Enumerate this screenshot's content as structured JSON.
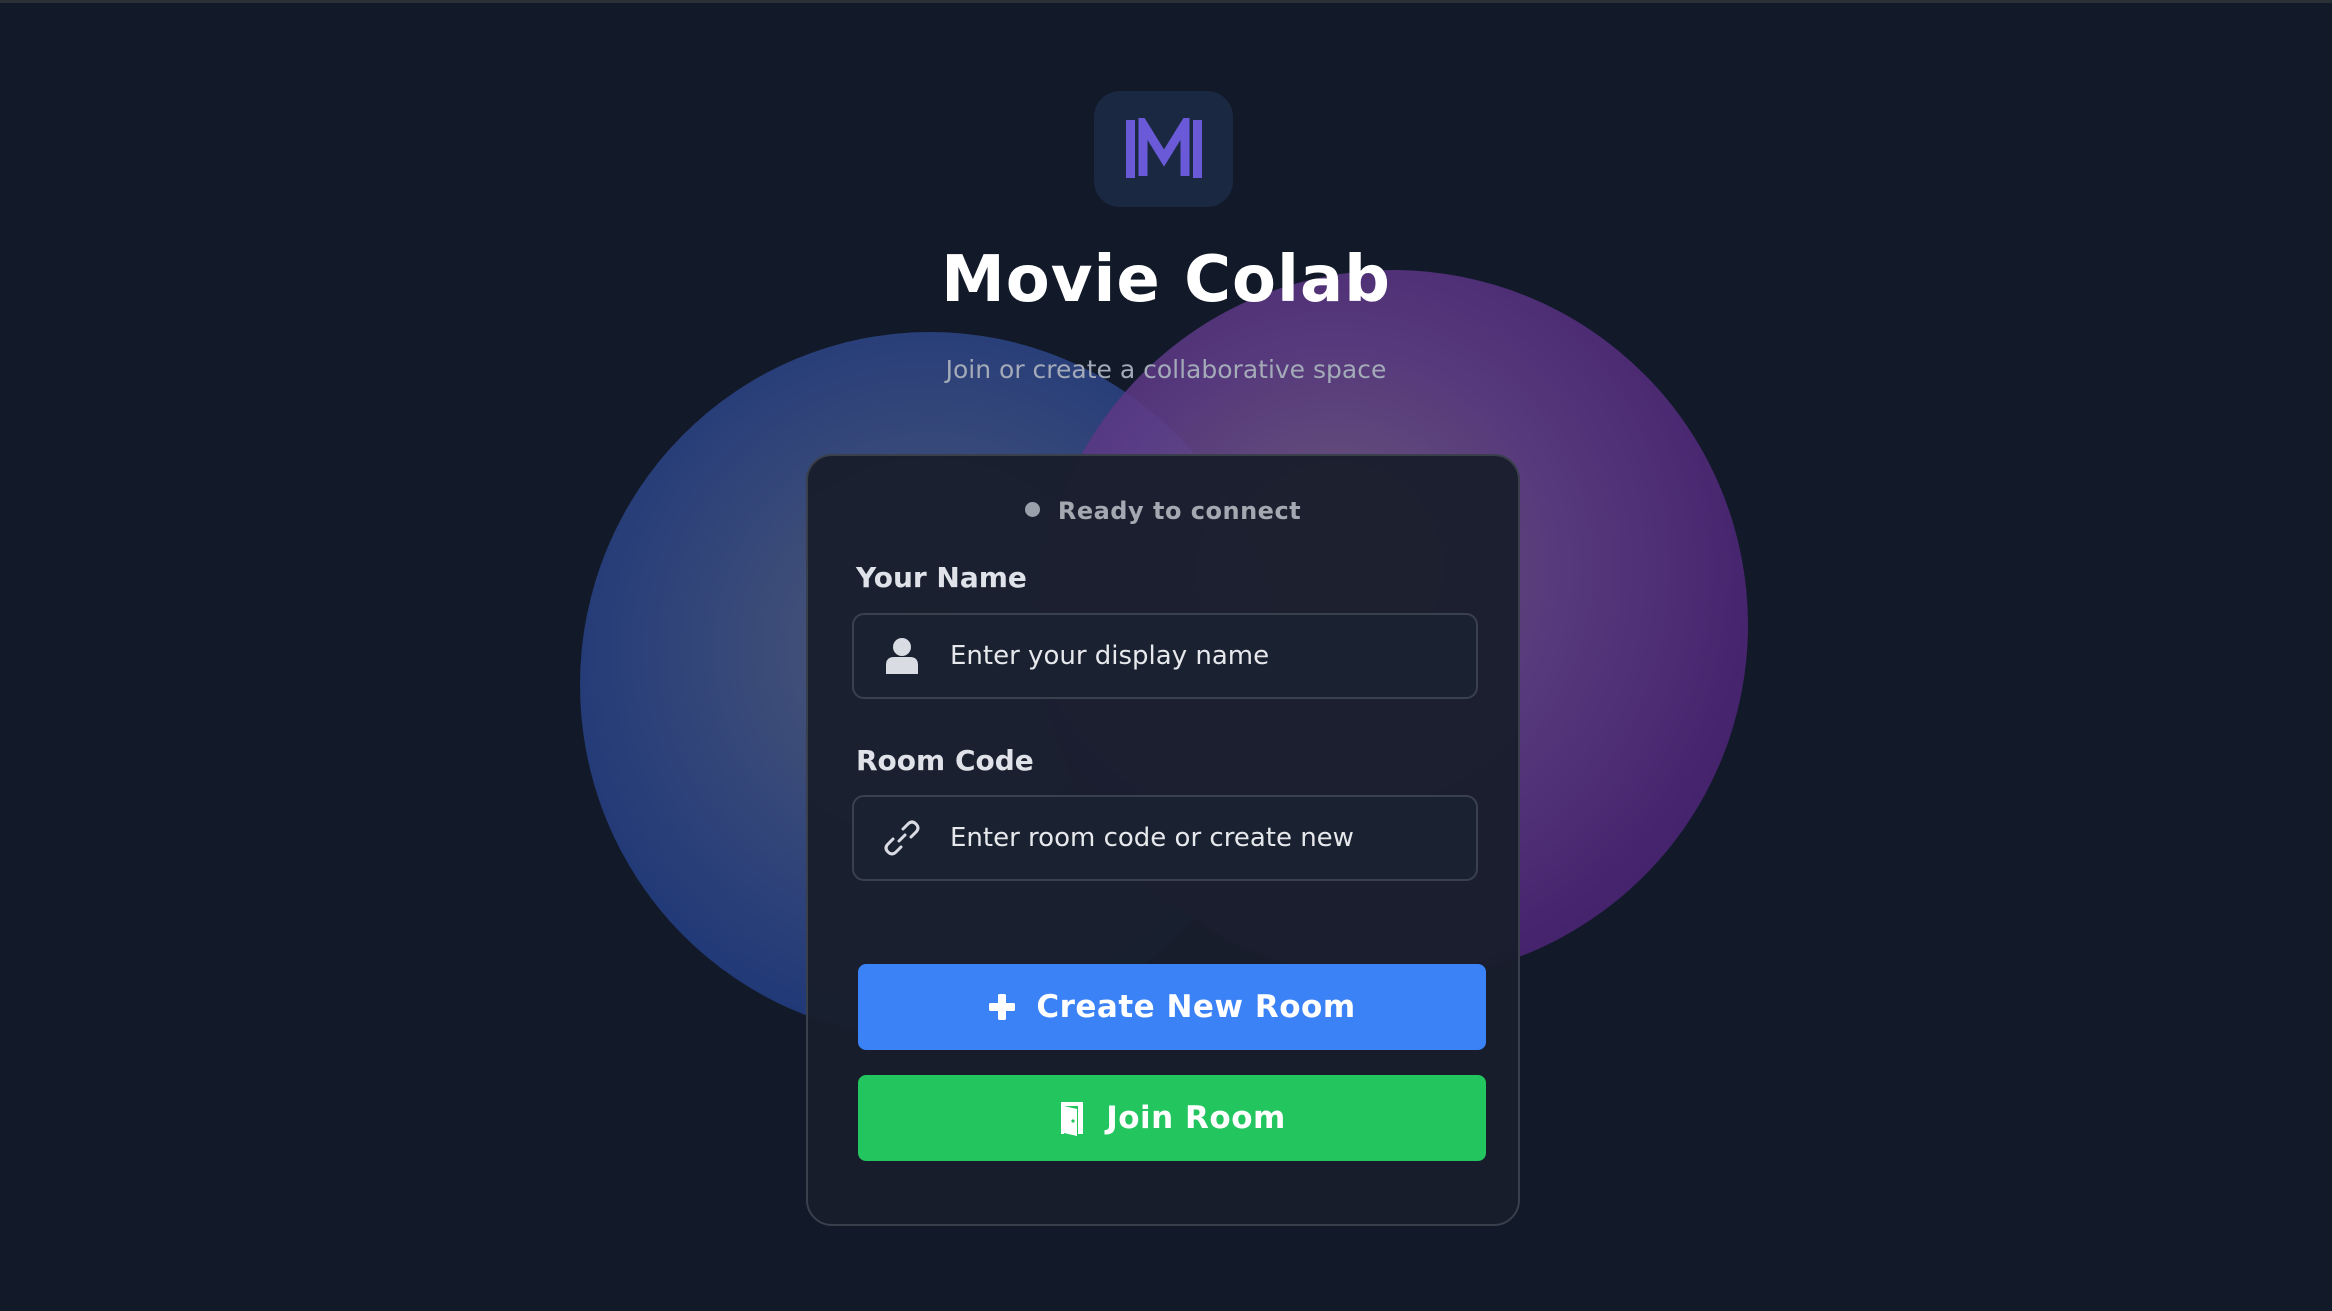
{
  "app": {
    "title": "Movie Colab",
    "subtitle": "Join or create a collaborative space",
    "logo_icon": "movie-colab-logo",
    "logo_color": "#6a5ad8"
  },
  "status": {
    "text": "Ready to connect",
    "dot_color": "#9aa0aa"
  },
  "form": {
    "name": {
      "label": "Your Name",
      "placeholder": "Enter your display name",
      "value": "",
      "icon": "user-icon"
    },
    "room": {
      "label": "Room Code",
      "placeholder": "Enter room code or create new",
      "value": "",
      "icon": "link-icon"
    }
  },
  "actions": {
    "create": {
      "label": "Create New Room",
      "icon": "plus-icon",
      "color": "#3b82f6"
    },
    "join": {
      "label": "Join Room",
      "icon": "door-icon",
      "color": "#22c55e"
    }
  }
}
